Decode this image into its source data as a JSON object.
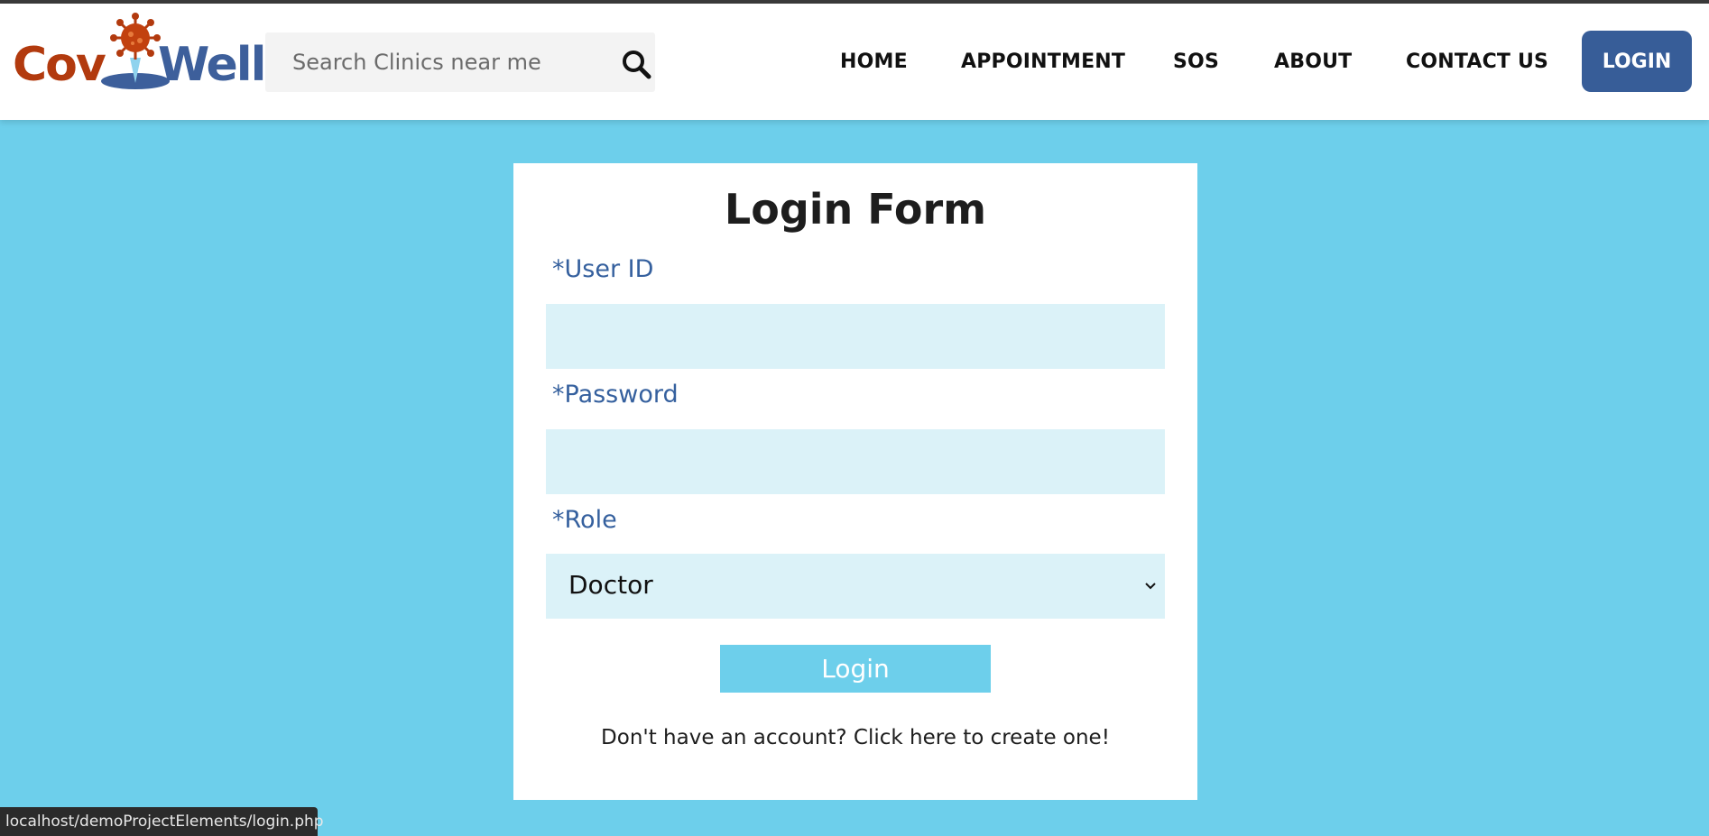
{
  "brand": {
    "name_part1": "Cov",
    "name_part2": "Well",
    "colors": {
      "primary_red": "#b23a0e",
      "primary_blue": "#3d5f9b"
    }
  },
  "search": {
    "placeholder": "Search Clinics near me",
    "icon": "search-icon"
  },
  "nav": {
    "items": [
      {
        "label": "HOME"
      },
      {
        "label": "APPOINTMENT"
      },
      {
        "label": "SOS"
      },
      {
        "label": "ABOUT"
      },
      {
        "label": "CONTACT US"
      }
    ],
    "login_label": "LOGIN"
  },
  "form": {
    "title": "Login Form",
    "user_id_label": "*User ID",
    "user_id_value": "",
    "password_label": "*Password",
    "password_value": "",
    "role_label": "*Role",
    "role_selected": "Doctor",
    "submit_label": "Login",
    "signup_text": "Don't have an account? Click here to create one!"
  },
  "status_bar": {
    "url": "localhost/demoProjectElements/login.php"
  },
  "colors": {
    "page_background": "#6dcfeb",
    "input_background": "#dbf2f8",
    "label_color": "#35609e",
    "login_button": "#375d98"
  }
}
